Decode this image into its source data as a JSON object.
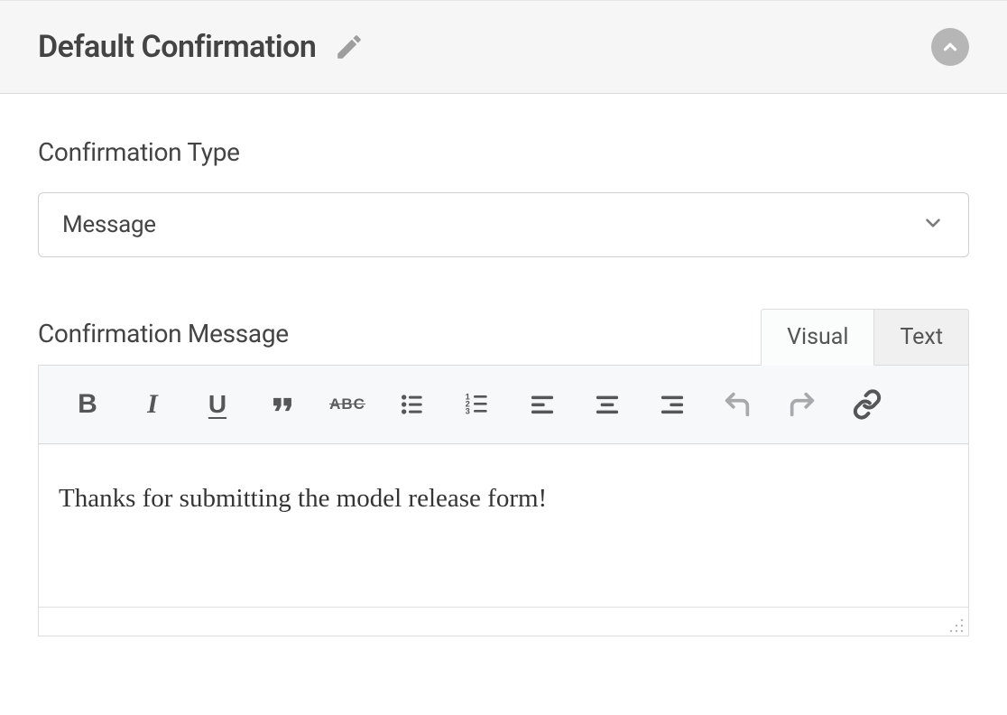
{
  "header": {
    "title": "Default Confirmation"
  },
  "fields": {
    "type_label": "Confirmation Type",
    "type_value": "Message",
    "message_label": "Confirmation Message"
  },
  "tabs": {
    "visual": "Visual",
    "text": "Text",
    "active": "visual"
  },
  "toolbar": {
    "bold": "B",
    "italic": "I",
    "underline": "U",
    "strike": "ABC"
  },
  "editor": {
    "content": "Thanks for submitting the model release form!"
  }
}
